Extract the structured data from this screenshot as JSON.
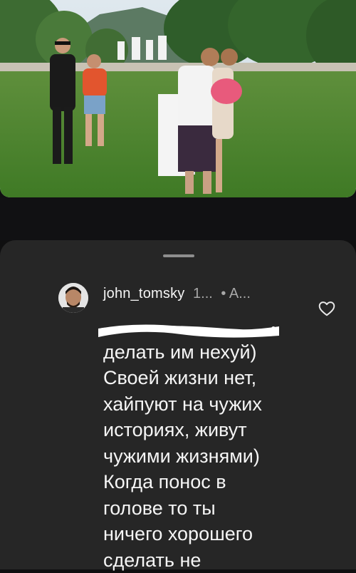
{
  "comment": {
    "username": "john_tomsky",
    "time_short": "1...",
    "extra_short": "• A...",
    "lines": [
      "",
      "делать им нехуй)",
      "Своей жизни нет,",
      "хайпуют на чужих",
      "историях, живут",
      "чужими жизнями)",
      "Когда понос в",
      "голове то ты",
      "ничего хорошего",
      "сделать не"
    ]
  },
  "icons": {
    "like": "heart-outline-icon",
    "avatar": "profile-avatar"
  },
  "colors": {
    "sheet_bg": "#262626",
    "text": "#f5f5f5",
    "muted": "#a8a8a8",
    "redaction": "#ffffff"
  }
}
